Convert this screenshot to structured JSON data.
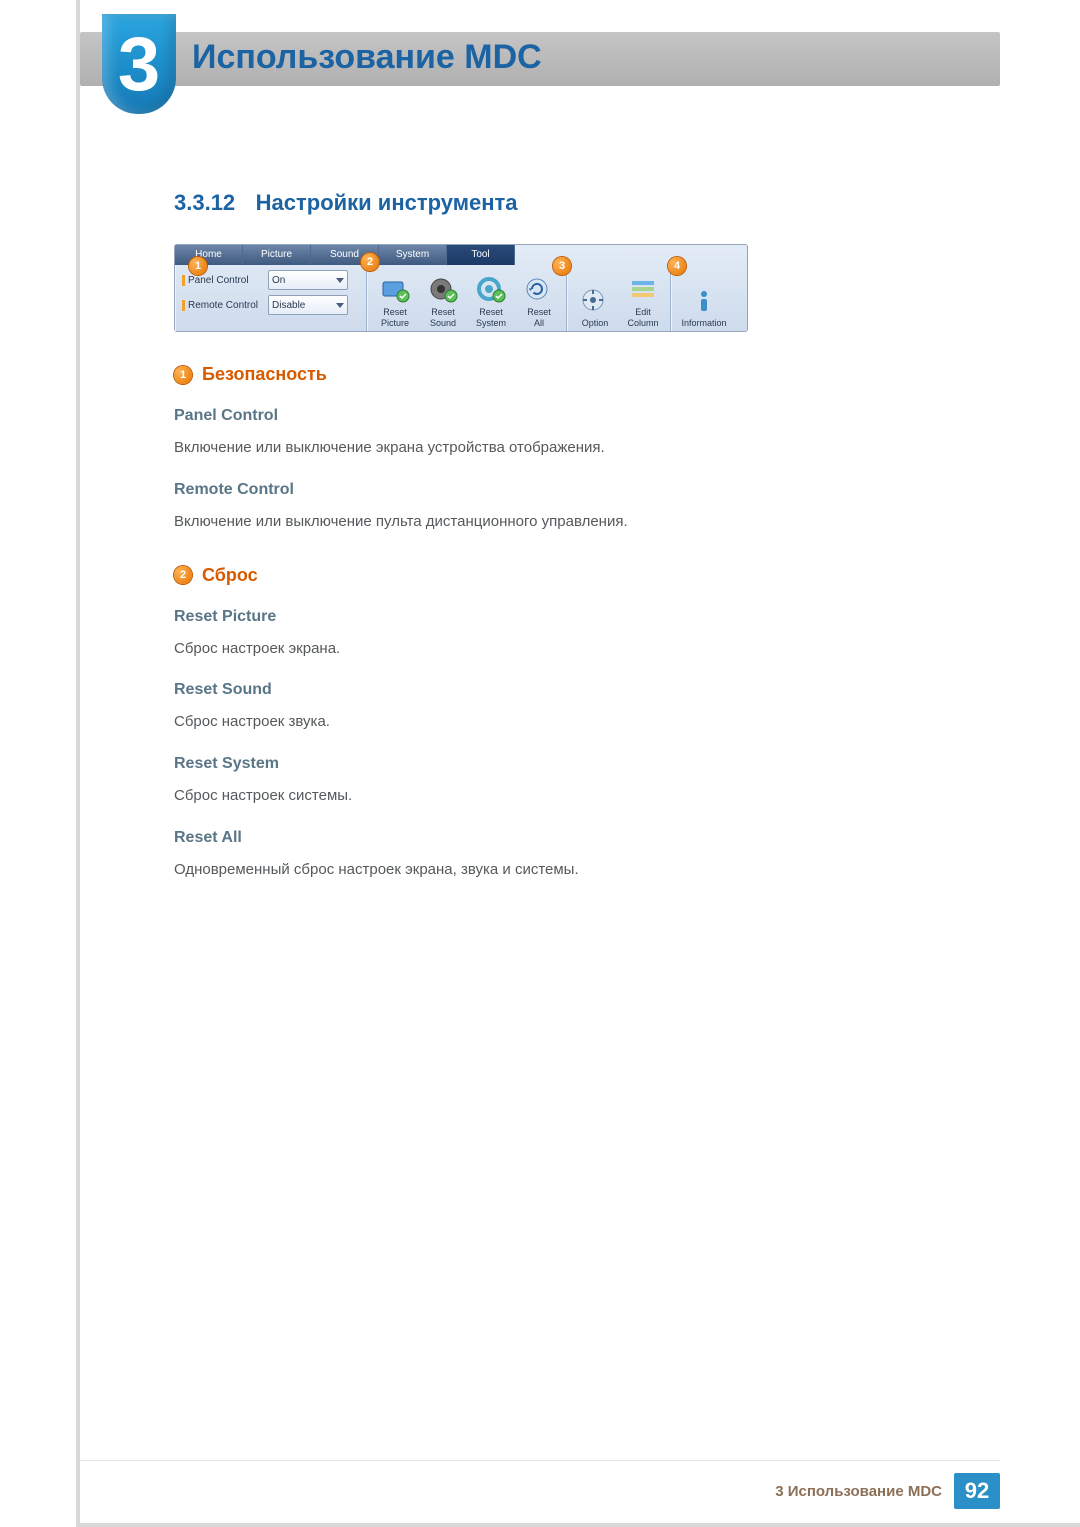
{
  "chapter": {
    "badge": "3",
    "title": "Использование MDC"
  },
  "section": {
    "number": "3.3.12",
    "title": "Настройки инструмента"
  },
  "toolbar": {
    "tabs": [
      "Home",
      "Picture",
      "Sound",
      "System",
      "Tool"
    ],
    "selected_tab": 4,
    "panel": {
      "rows": [
        {
          "label": "Panel Control",
          "value": "On"
        },
        {
          "label": "Remote Control",
          "value": "Disable"
        }
      ]
    },
    "reset": [
      "Reset Picture",
      "Reset Sound",
      "Reset System",
      "Reset All"
    ],
    "tools": [
      "Option",
      "Edit Column",
      "Information"
    ]
  },
  "callouts": [
    "1",
    "2",
    "3",
    "4"
  ],
  "sections": [
    {
      "num": "1",
      "title": "Безопасность",
      "items": [
        {
          "h": "Panel Control",
          "p": "Включение или выключение экрана устройства отображения."
        },
        {
          "h": "Remote Control",
          "p": "Включение или выключение пульта дистанционного управления."
        }
      ]
    },
    {
      "num": "2",
      "title": "Сброс",
      "items": [
        {
          "h": "Reset Picture",
          "p": "Сброс настроек экрана."
        },
        {
          "h": "Reset Sound",
          "p": "Сброс настроек звука."
        },
        {
          "h": "Reset System",
          "p": "Сброс настроек системы."
        },
        {
          "h": "Reset All",
          "p": "Одновременный сброс настроек экрана, звука и системы."
        }
      ]
    }
  ],
  "footer": {
    "text": "3 Использование MDC",
    "page": "92"
  }
}
